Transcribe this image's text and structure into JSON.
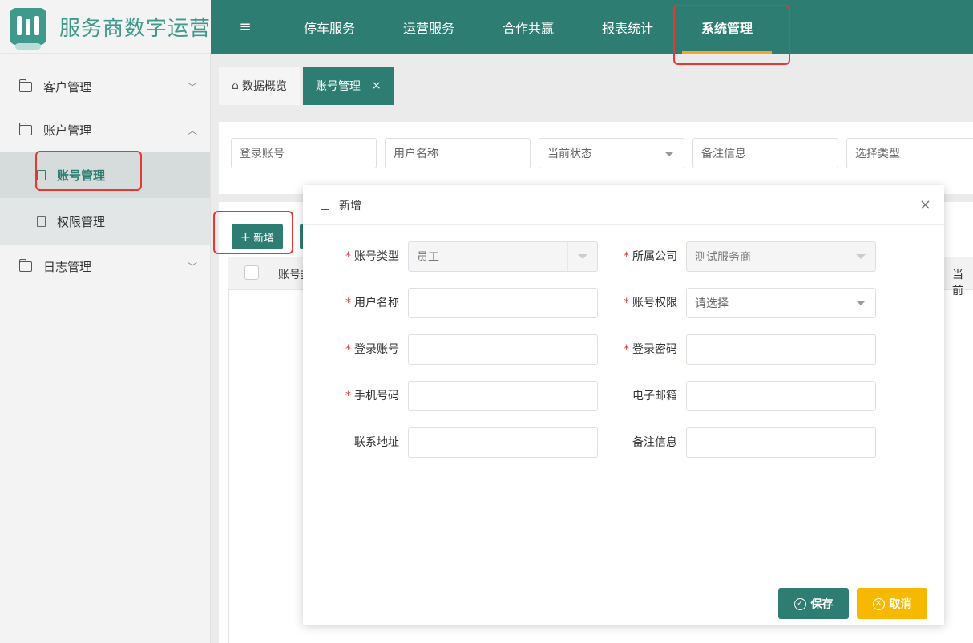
{
  "app": {
    "title": "服务商数字运营"
  },
  "topnav": {
    "toggle_icon": "≡",
    "items": [
      "停车服务",
      "运营服务",
      "合作共赢",
      "报表统计",
      "系统管理"
    ],
    "active_index": 4
  },
  "sidebar": {
    "groups": [
      {
        "label": "客户管理",
        "expanded": false
      },
      {
        "label": "账户管理",
        "expanded": true,
        "children": [
          "账号管理",
          "权限管理"
        ]
      },
      {
        "label": "日志管理",
        "expanded": false
      }
    ],
    "active_child": "账号管理"
  },
  "tabs": [
    {
      "label": "数据概览",
      "active": false
    },
    {
      "label": "账号管理",
      "active": true,
      "close": "×"
    }
  ],
  "filters": {
    "login_account": "登录账号",
    "user_name": "用户名称",
    "status": "当前状态",
    "remark": "备注信息",
    "type": "选择类型"
  },
  "toolbar": {
    "add_label": "新增",
    "add_icon": "+"
  },
  "table": {
    "headers": [
      "账号类",
      "当前"
    ]
  },
  "modal": {
    "title": "新增",
    "close": "×",
    "fields": {
      "account_type": {
        "label": "账号类型",
        "value": "员工",
        "required": true
      },
      "company": {
        "label": "所属公司",
        "value": "测试服务商",
        "required": true
      },
      "user_name": {
        "label": "用户名称",
        "value": "",
        "required": true
      },
      "permission": {
        "label": "账号权限",
        "value": "请选择",
        "required": true
      },
      "login_account": {
        "label": "登录账号",
        "value": "",
        "required": true
      },
      "password": {
        "label": "登录密码",
        "value": "",
        "required": true
      },
      "phone": {
        "label": "手机号码",
        "value": "",
        "required": true
      },
      "email": {
        "label": "电子邮箱",
        "value": "",
        "required": false
      },
      "address": {
        "label": "联系地址",
        "value": "",
        "required": false
      },
      "remark": {
        "label": "备注信息",
        "value": "",
        "required": false
      }
    },
    "required_mark": "*",
    "save_label": "保存",
    "save_icon": "✓",
    "cancel_label": "取消",
    "cancel_icon": "✕"
  },
  "colors": {
    "primary": "#2e7d72",
    "accent": "#f5a623",
    "cancel": "#f7b900",
    "highlight": "#e53935"
  }
}
